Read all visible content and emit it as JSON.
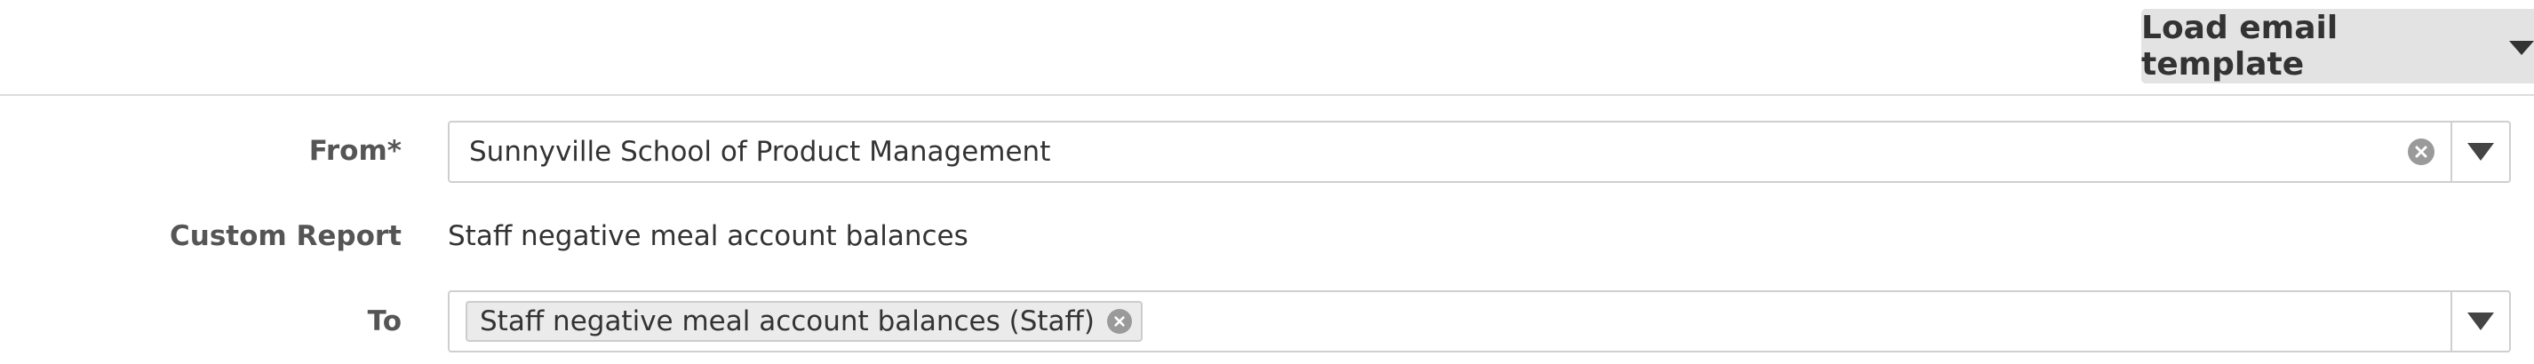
{
  "toolbar": {
    "load_template_label": "Load email template",
    "caret_icon": "caret-down-icon"
  },
  "form": {
    "from": {
      "label": "From*",
      "value": "Sunnyville School of Product Management",
      "clear_icon": "clear-circle-icon",
      "toggle_icon": "triangle-down-icon"
    },
    "custom_report": {
      "label": "Custom Report",
      "value": "Staff negative meal account balances"
    },
    "to": {
      "label": "To",
      "tags": [
        {
          "label": "Staff negative meal account balances (Staff)"
        }
      ],
      "remove_icon": "remove-tag-icon",
      "toggle_icon": "triangle-down-icon"
    }
  },
  "colors": {
    "button_bg": "#e3e3e3",
    "border": "#cfcfcf",
    "label_text": "#555555",
    "body_text": "#333333",
    "icon_gray": "#9a9a9a"
  }
}
